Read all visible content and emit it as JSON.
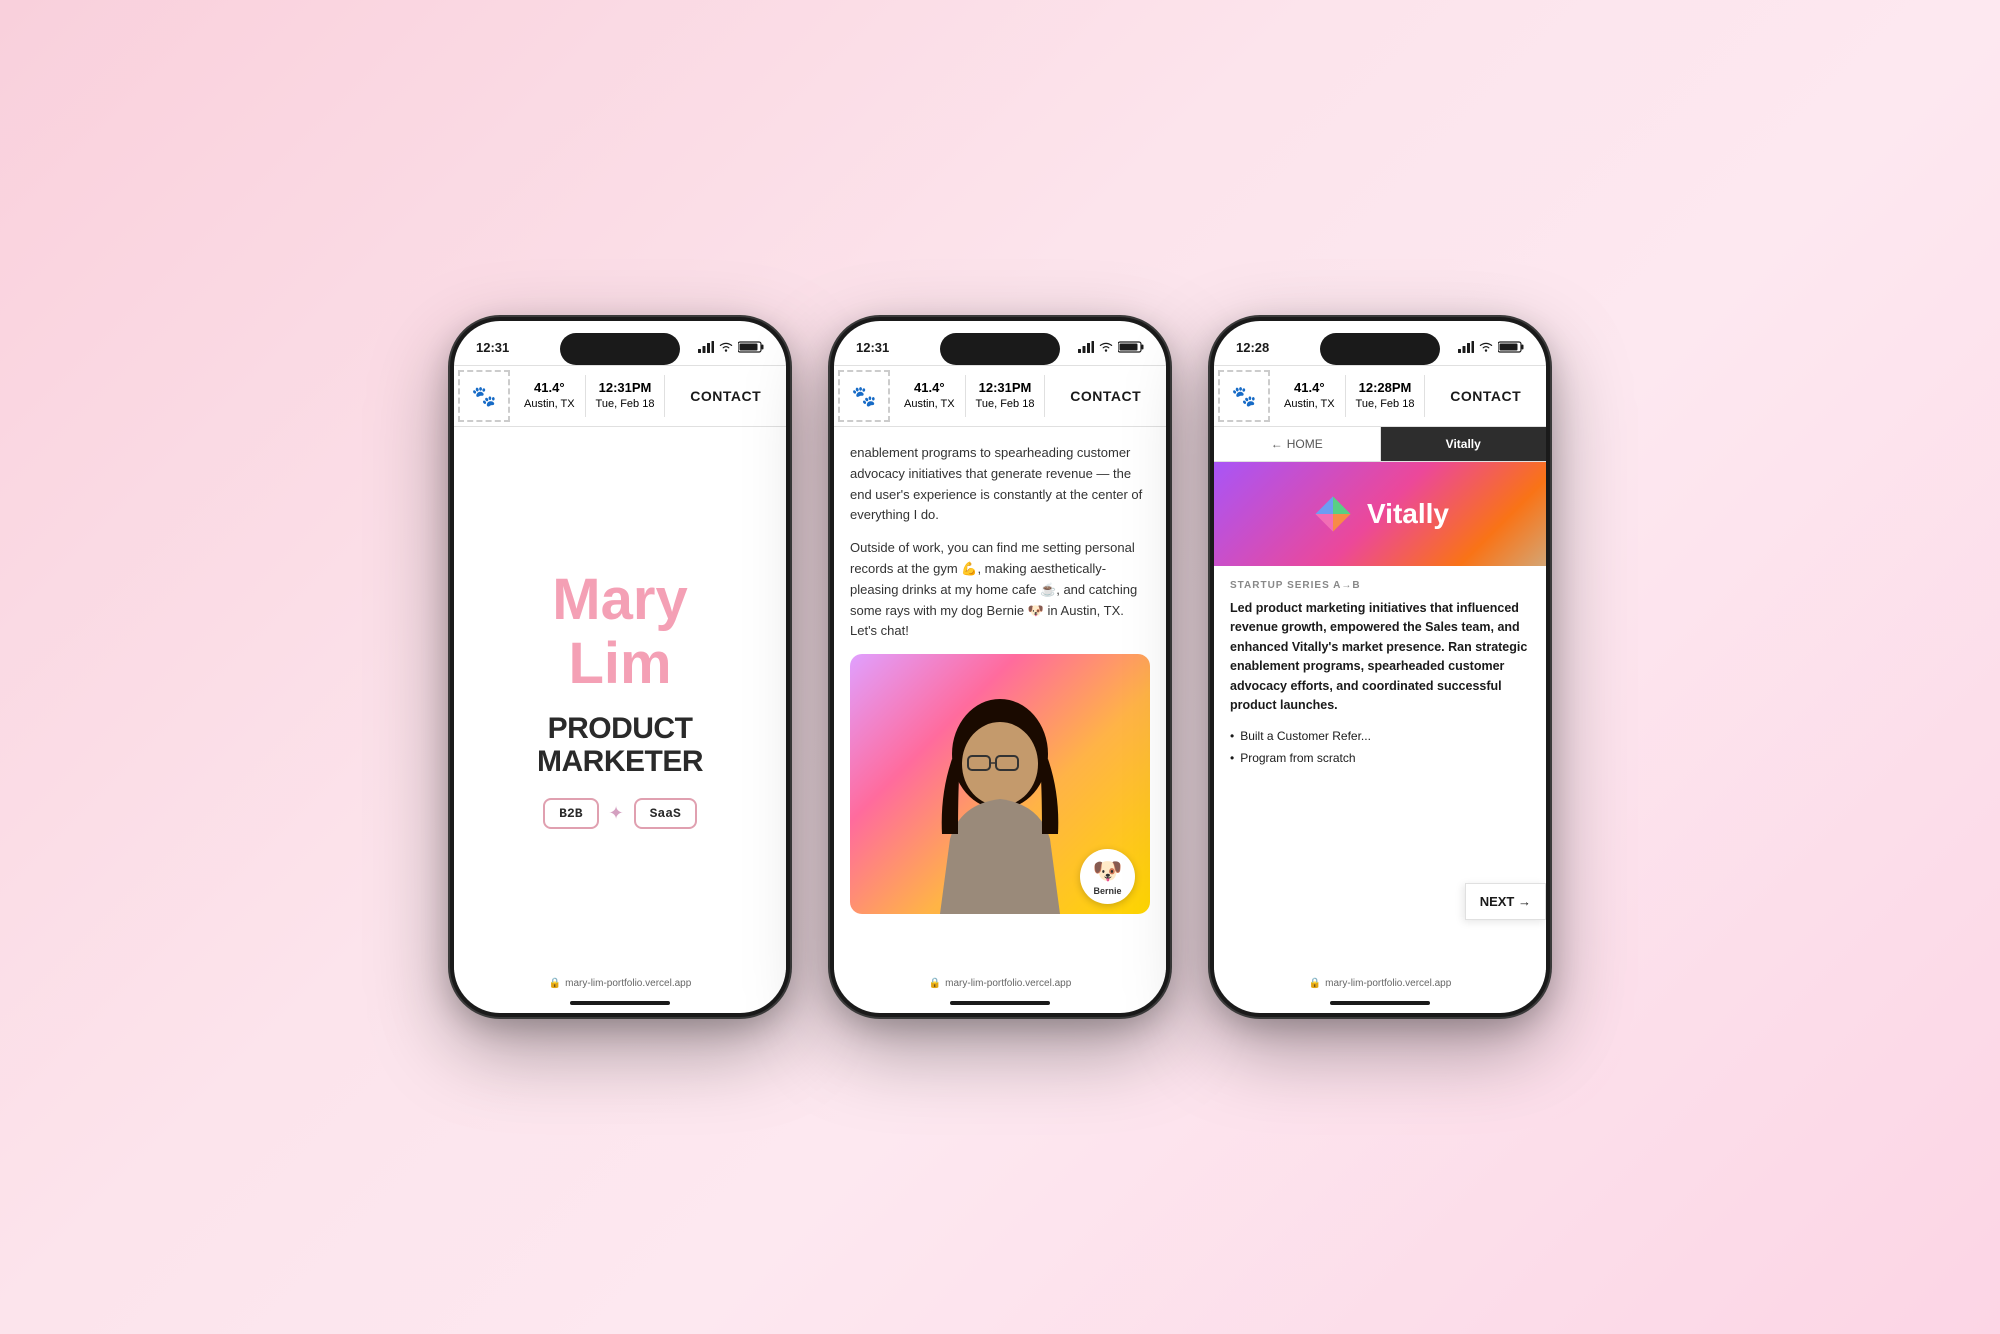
{
  "background": {
    "gradient_start": "#f9d0dc",
    "gradient_end": "#fcd5e5"
  },
  "phone1": {
    "status": {
      "time": "12:31",
      "signal": "●●●",
      "wifi": "wifi",
      "battery": "battery"
    },
    "header": {
      "stamp_emoji": "🐱",
      "temp": "41.4°",
      "location": "Austin, TX",
      "time": "12:31PM",
      "date": "Tue, Feb 18",
      "contact": "CONTACT"
    },
    "hero": {
      "name_line1": "Mary",
      "name_line2": "Lim",
      "role_line1": "PRODUCT",
      "role_line2": "MARKETER",
      "tag1": "B2B",
      "star": "✦",
      "tag2": "SaaS"
    },
    "url": "mary-lim-portfolio.vercel.app"
  },
  "phone2": {
    "status": {
      "time": "12:31",
      "signal": "●●●",
      "wifi": "wifi",
      "battery": "battery"
    },
    "header": {
      "stamp_emoji": "🐱",
      "temp": "41.4°",
      "location": "Austin, TX",
      "time": "12:31PM",
      "date": "Tue, Feb 18",
      "contact": "CONTACT"
    },
    "content": {
      "para1": "enablement programs to spearheading customer advocacy initiatives that generate revenue — the end user's experience is constantly at the center of everything I do.",
      "para2": "Outside of work, you can find me setting personal records at the gym 💪, making aesthetically-pleasing drinks at my home cafe ☕, and catching some rays with my dog Bernie 🐶 in Austin, TX. Let's chat!",
      "bernie_label": "Bernie"
    },
    "url": "mary-lim-portfolio.vercel.app"
  },
  "phone3": {
    "status": {
      "time": "12:28",
      "signal": "●●●",
      "wifi": "wifi",
      "battery": "battery"
    },
    "header": {
      "stamp_emoji": "🐱",
      "temp": "41.4°",
      "location": "Austin, TX",
      "time": "12:28PM",
      "date": "Tue, Feb 18",
      "contact": "CONTACT"
    },
    "nav": {
      "home_arrow": "←",
      "home_label": "HOME",
      "active_tab": "Vitally"
    },
    "work": {
      "company": "Vitally",
      "series": "STARTUP SERIES A→B",
      "description": "Led product marketing initiatives that influenced revenue growth, empowered the Sales team, and enhanced Vitally's market presence. Ran strategic enablement programs, spearheaded customer advocacy efforts, and coordinated successful product launches.",
      "bullet1": "Built a Customer Refer...",
      "bullet2": "Program from scratch",
      "next_label": "NEXT →"
    },
    "url": "mary-lim-portfolio.vercel.app"
  }
}
